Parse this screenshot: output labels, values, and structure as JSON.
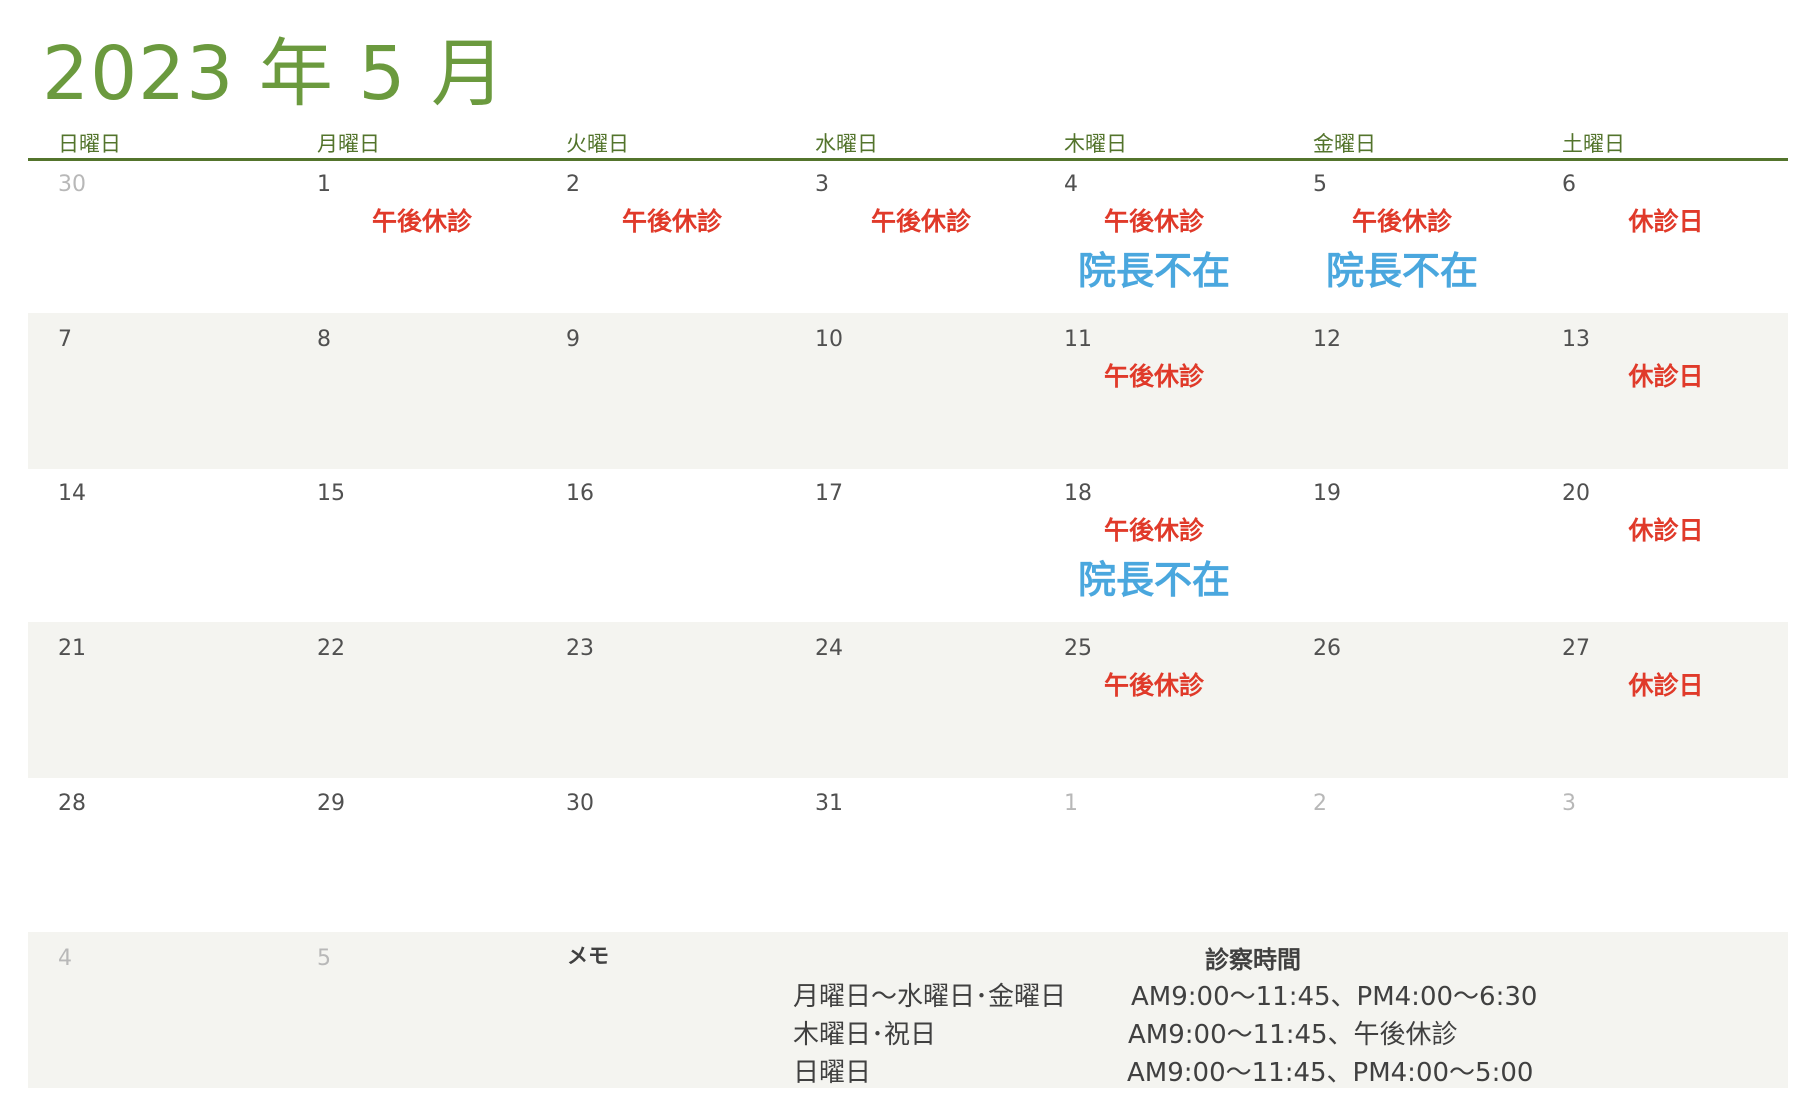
{
  "title": "2023 年 5 月",
  "weekdays": [
    "日曜日",
    "月曜日",
    "火曜日",
    "水曜日",
    "木曜日",
    "金曜日",
    "土曜日"
  ],
  "weeks": [
    [
      {
        "date": "30",
        "other": true,
        "events": []
      },
      {
        "date": "1",
        "events": [
          "午後休診"
        ]
      },
      {
        "date": "2",
        "events": [
          "午後休診"
        ]
      },
      {
        "date": "3",
        "events": [
          "午後休診"
        ]
      },
      {
        "date": "4",
        "events": [
          "午後休診"
        ],
        "absent": "院長不在"
      },
      {
        "date": "5",
        "events": [
          "午後休診"
        ],
        "absent": "院長不在"
      },
      {
        "date": "6",
        "events": [
          "休診日"
        ]
      }
    ],
    [
      {
        "date": "7",
        "events": []
      },
      {
        "date": "8",
        "events": []
      },
      {
        "date": "9",
        "events": []
      },
      {
        "date": "10",
        "events": []
      },
      {
        "date": "11",
        "events": [
          "午後休診"
        ]
      },
      {
        "date": "12",
        "events": []
      },
      {
        "date": "13",
        "events": [
          "休診日"
        ]
      }
    ],
    [
      {
        "date": "14",
        "events": []
      },
      {
        "date": "15",
        "events": []
      },
      {
        "date": "16",
        "events": []
      },
      {
        "date": "17",
        "events": []
      },
      {
        "date": "18",
        "events": [
          "午後休診"
        ],
        "absent": "院長不在"
      },
      {
        "date": "19",
        "events": []
      },
      {
        "date": "20",
        "events": [
          "休診日"
        ]
      }
    ],
    [
      {
        "date": "21",
        "events": []
      },
      {
        "date": "22",
        "events": []
      },
      {
        "date": "23",
        "events": []
      },
      {
        "date": "24",
        "events": []
      },
      {
        "date": "25",
        "events": [
          "午後休診"
        ]
      },
      {
        "date": "26",
        "events": []
      },
      {
        "date": "27",
        "events": [
          "休診日"
        ]
      }
    ],
    [
      {
        "date": "28",
        "events": []
      },
      {
        "date": "29",
        "events": []
      },
      {
        "date": "30",
        "events": []
      },
      {
        "date": "31",
        "events": []
      },
      {
        "date": "1",
        "other": true,
        "events": []
      },
      {
        "date": "2",
        "other": true,
        "events": []
      },
      {
        "date": "3",
        "other": true,
        "events": []
      }
    ],
    [
      {
        "date": "4",
        "other": true,
        "events": []
      },
      {
        "date": "5",
        "other": true,
        "events": []
      }
    ]
  ],
  "memo": {
    "label": "メモ",
    "hours_title": "診察時間",
    "hours": [
      {
        "days": "月曜日～水曜日･金曜日",
        "time": "AM9:00～11:45、PM4:00～6:30"
      },
      {
        "days": "木曜日･祝日",
        "time": "AM9:00～11:45、午後休診"
      },
      {
        "days": "日曜日",
        "time": "AM9:00～11:45、PM4:00～5:00"
      }
    ]
  },
  "colors": {
    "title": "#6b9a3e",
    "header": "#53742c",
    "closed": "#e03a2a",
    "absent": "#4aa7de",
    "shade": "#f4f4f0"
  }
}
